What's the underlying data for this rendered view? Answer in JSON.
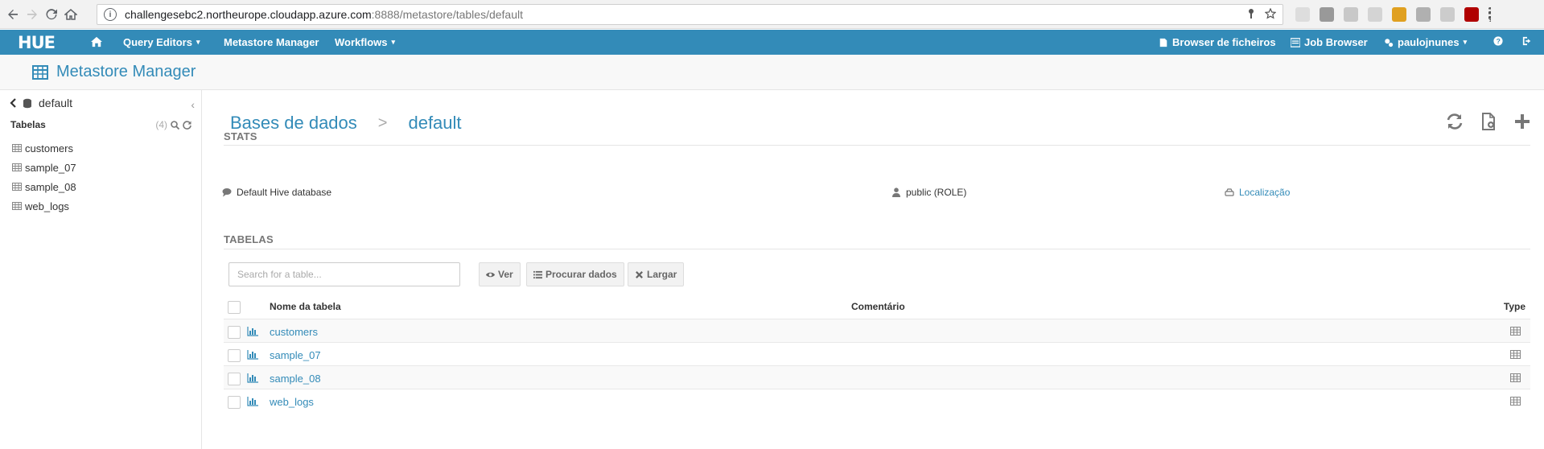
{
  "browser": {
    "url_host": "challengesebc2.northeurope.cloudapp.azure.com",
    "url_path": ":8888/metastore/tables/default",
    "info_label": "i"
  },
  "navbar": {
    "logo": "HUE",
    "home_icon": "home-icon",
    "query_editors": "Query Editors",
    "metastore_manager": "Metastore Manager",
    "workflows": "Workflows",
    "file_browser": "Browser de ficheiros",
    "job_browser": "Job Browser",
    "user": "paulojnunes",
    "caret": "▾",
    "help_icon": "question-icon",
    "logout_icon": "logout-icon"
  },
  "subheader": {
    "title": "Metastore Manager"
  },
  "left_panel": {
    "database": "default",
    "collapse": "‹",
    "tables_header": "Tabelas",
    "count": "(4)",
    "tables": [
      {
        "name": "customers"
      },
      {
        "name": "sample_07"
      },
      {
        "name": "sample_08"
      },
      {
        "name": "web_logs"
      }
    ]
  },
  "main": {
    "breadcrumb_root": "Bases de dados",
    "breadcrumb_sep": ">",
    "breadcrumb_current": "default",
    "stats_title": "STATS",
    "comment": "Default Hive database",
    "owner": "public (ROLE)",
    "location_link": "Localização",
    "tables_title": "TABELAS",
    "search_placeholder": "Search for a table...",
    "btn_view": "Ver",
    "btn_browse": "Procurar dados",
    "btn_drop": "Largar",
    "columns": {
      "name": "Nome da tabela",
      "comment": "Comentário",
      "type": "Type"
    },
    "rows": [
      {
        "name": "customers"
      },
      {
        "name": "sample_07"
      },
      {
        "name": "sample_08"
      },
      {
        "name": "web_logs"
      }
    ]
  },
  "colors": {
    "brand": "#338bb8",
    "link": "#338bb8",
    "muted": "#777777"
  }
}
